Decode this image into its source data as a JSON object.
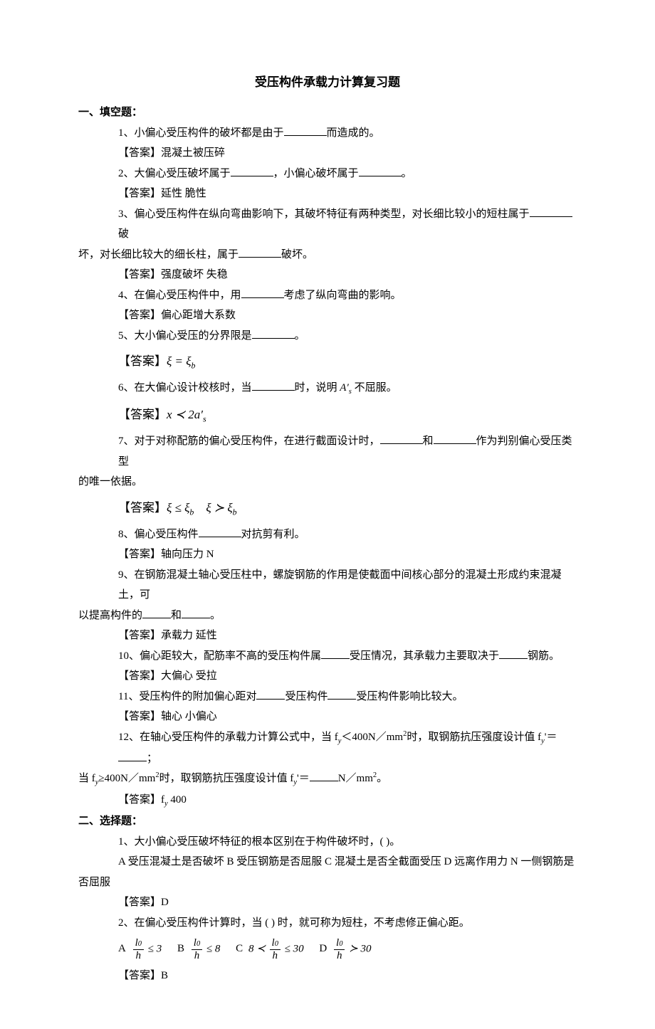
{
  "title": "受压构件承载力计算复习题",
  "section1": {
    "heading": "一、填空题：",
    "q1": "1、小偏心受压构件的破坏都是由于",
    "q1_tail": "而造成的。",
    "a1": "【答案】混凝土被压碎",
    "q2_a": "2、大偏心受压破坏属于",
    "q2_b": "，小偏心破坏属于",
    "q2_tail": "。",
    "a2": "【答案】延性    脆性",
    "q3_a": "3、偏心受压构件在纵向弯曲影响下，其破坏特征有两种类型，对长细比较小的短柱属于",
    "q3_b": "破",
    "q3_line2_a": "坏，对长细比较大的细长柱，属于",
    "q3_line2_b": "破坏。",
    "a3": "【答案】强度破坏    失稳",
    "q4_a": "4、在偏心受压构件中，用",
    "q4_b": "考虑了纵向弯曲的影响。",
    "a4": "【答案】偏心距增大系数",
    "q5_a": "5、大小偏心受压的分界限是",
    "q5_b": "。",
    "a5_label": "【答案】",
    "a5_formula": "ξ = ξ_b",
    "q6_a": "6、在大偏心设计校核时，当",
    "q6_b": "时，说明",
    "q6_c": "不屈服。",
    "q6_formula_mid": "A′_s",
    "a6_label": "【答案】",
    "a6_formula": "x ≺ 2a′_s",
    "q7_a": "7、对于对称配筋的偏心受压构件，在进行截面设计时，",
    "q7_b": "和",
    "q7_c": "作为判别偏心受压类型",
    "q7_line2": "的唯一依据。",
    "a7_label": "【答案】",
    "a7_formula1": "ξ ≤ ξ_b",
    "a7_formula2": "ξ ≻ ξ_b",
    "q8_a": "8、偏心受压构件",
    "q8_b": "对抗剪有利。",
    "a8": "【答案】轴向压力 N",
    "q9_a": "9、在钢筋混凝土轴心受压柱中，螺旋钢筋的作用是使截面中间核心部分的混凝土形成约束混凝土，可",
    "q9_line2_a": "以提高构件的",
    "q9_line2_b": "和",
    "q9_line2_c": "。",
    "a9": "【答案】承载力      延性",
    "q10_a": "10、偏心距较大，配筋率不高的受压构件属",
    "q10_b": "受压情况，其承载力主要取决于",
    "q10_c": "钢筋。",
    "a10": "【答案】大偏心      受拉",
    "q11_a": "11、受压构件的附加偏心距对",
    "q11_b": "受压构件",
    "q11_c": "受压构件影响比较大。",
    "a11": "【答案】轴心      小偏心",
    "q12_a": "12、在轴心受压构件的承载力计算公式中，当 f",
    "q12_b": "＜400N／mm",
    "q12_c": "时，取钢筋抗压强度设计值 f",
    "q12_d": "'＝",
    "q12_e": "；",
    "q12_line2_a": "当 f",
    "q12_line2_b": "≥400N／mm",
    "q12_line2_c": "时，取钢筋抗压强度设计值 f",
    "q12_line2_d": "'＝",
    "q12_line2_e": "N／mm",
    "q12_line2_f": "。",
    "a12": "【答案】f",
    "a12_tail": "      400",
    "sub_y": "y",
    "sup_2": "2"
  },
  "section2": {
    "heading": "二、选择题：",
    "q1": "1、大小偏心受压破坏特征的根本区别在于构件破坏时，(         )。",
    "q1_opts": "A 受压混凝土是否破坏    B 受压钢筋是否屈服    C 混凝土是否全截面受压    D 远离作用力 N 一侧钢筋是",
    "q1_opts_line2": "否屈服",
    "a1": "【答案】D",
    "q2": "2、在偏心受压构件计算时，当 (          ) 时，就可称为短柱，不考虑修正偏心距。",
    "optA": "A",
    "optB": "B",
    "optC": "C",
    "optD": "D",
    "f_l0": "l",
    "f_l0_sub": "0",
    "f_h": "h",
    "leq3": "≤ 3",
    "leq8": "≤ 8",
    "c_pre": "8 ≺",
    "leq30": "≤ 30",
    "gt30": "≻ 30",
    "a2": "【答案】B"
  }
}
